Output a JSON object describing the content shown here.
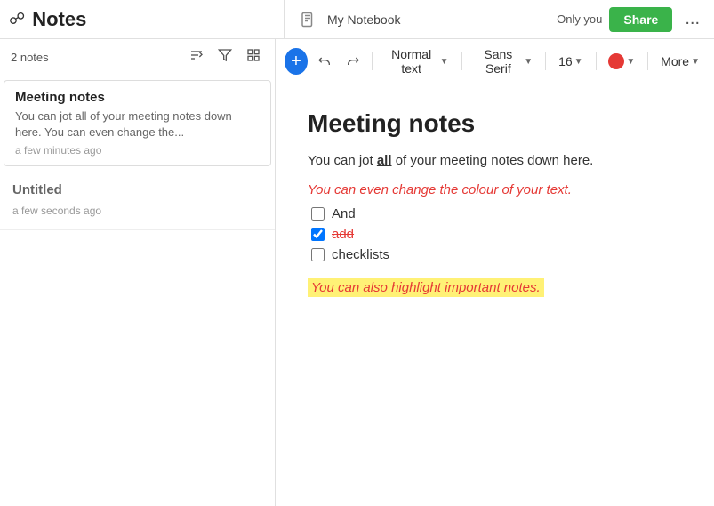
{
  "app": {
    "title": "Notes",
    "icon": "📋"
  },
  "header": {
    "notebook_icon": "📄",
    "notebook_title": "My Notebook",
    "only_you_label": "Only you",
    "share_button": "Share",
    "more_label": "..."
  },
  "sidebar": {
    "note_count": "2 notes",
    "sort_icon": "sort",
    "filter_icon": "filter",
    "layout_icon": "layout",
    "notes": [
      {
        "title": "Meeting notes",
        "preview": "You can jot all of your meeting notes down here. You can even change the...",
        "time": "a few minutes ago",
        "active": true
      },
      {
        "title": "Untitled",
        "preview": "",
        "time": "a few seconds ago",
        "active": false
      }
    ]
  },
  "toolbar": {
    "add_btn": "+",
    "undo_icon": "↩",
    "redo_icon": "↪",
    "text_style_label": "Normal text",
    "font_family_label": "Sans Serif",
    "font_size_label": "16",
    "color_label": "",
    "more_label": "More"
  },
  "editor": {
    "heading": "Meeting notes",
    "body_line1_prefix": "You can jot ",
    "body_line1_all": "all",
    "body_line1_suffix": " of your meeting notes down here.",
    "colored_text": "You can even change the colour of your text.",
    "checklist": [
      {
        "label": "And",
        "checked": false,
        "strikethrough": false
      },
      {
        "label": "add",
        "checked": true,
        "strikethrough": true
      },
      {
        "label": "checklists",
        "checked": false,
        "strikethrough": false
      }
    ],
    "highlight_text": "You can also highlight important notes."
  }
}
